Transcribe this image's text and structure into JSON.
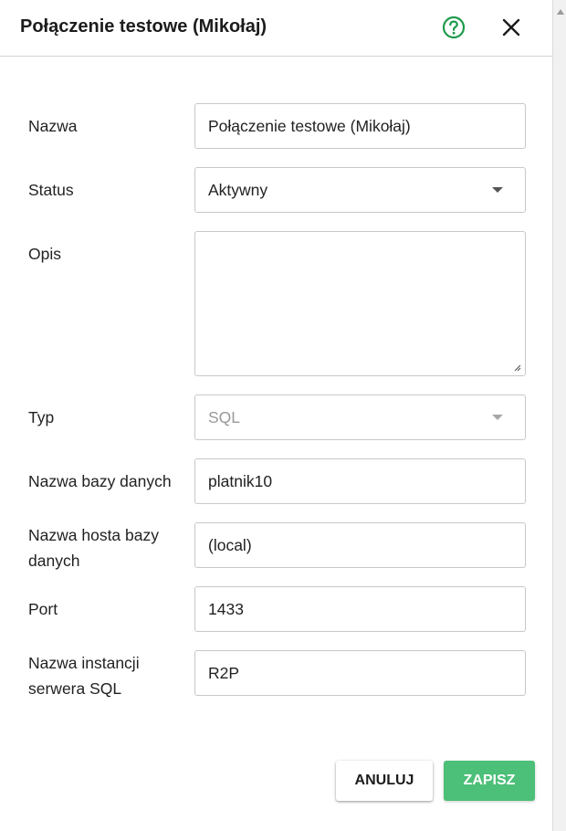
{
  "dialog": {
    "title": "Połączenie testowe (Mikołaj)",
    "help_icon": "help-circle-icon",
    "close_icon": "close-icon",
    "accent_color": "#1e9a4a"
  },
  "form": {
    "name": {
      "label": "Nazwa",
      "value": "Połączenie testowe (Mikołaj)"
    },
    "status": {
      "label": "Status",
      "value": "Aktywny"
    },
    "description": {
      "label": "Opis",
      "value": ""
    },
    "type": {
      "label": "Typ",
      "value": "SQL"
    },
    "database_name": {
      "label": "Nazwa bazy danych",
      "value": "platnik10"
    },
    "database_host": {
      "label": "Nazwa hosta bazy danych",
      "value": "(local)"
    },
    "port": {
      "label": "Port",
      "value": "1433"
    },
    "sql_instance": {
      "label": "Nazwa instancji serwera SQL",
      "value": "R2P"
    }
  },
  "actions": {
    "cancel_label": "ANULUJ",
    "save_label": "ZAPISZ",
    "save_color": "#4cbf78"
  }
}
